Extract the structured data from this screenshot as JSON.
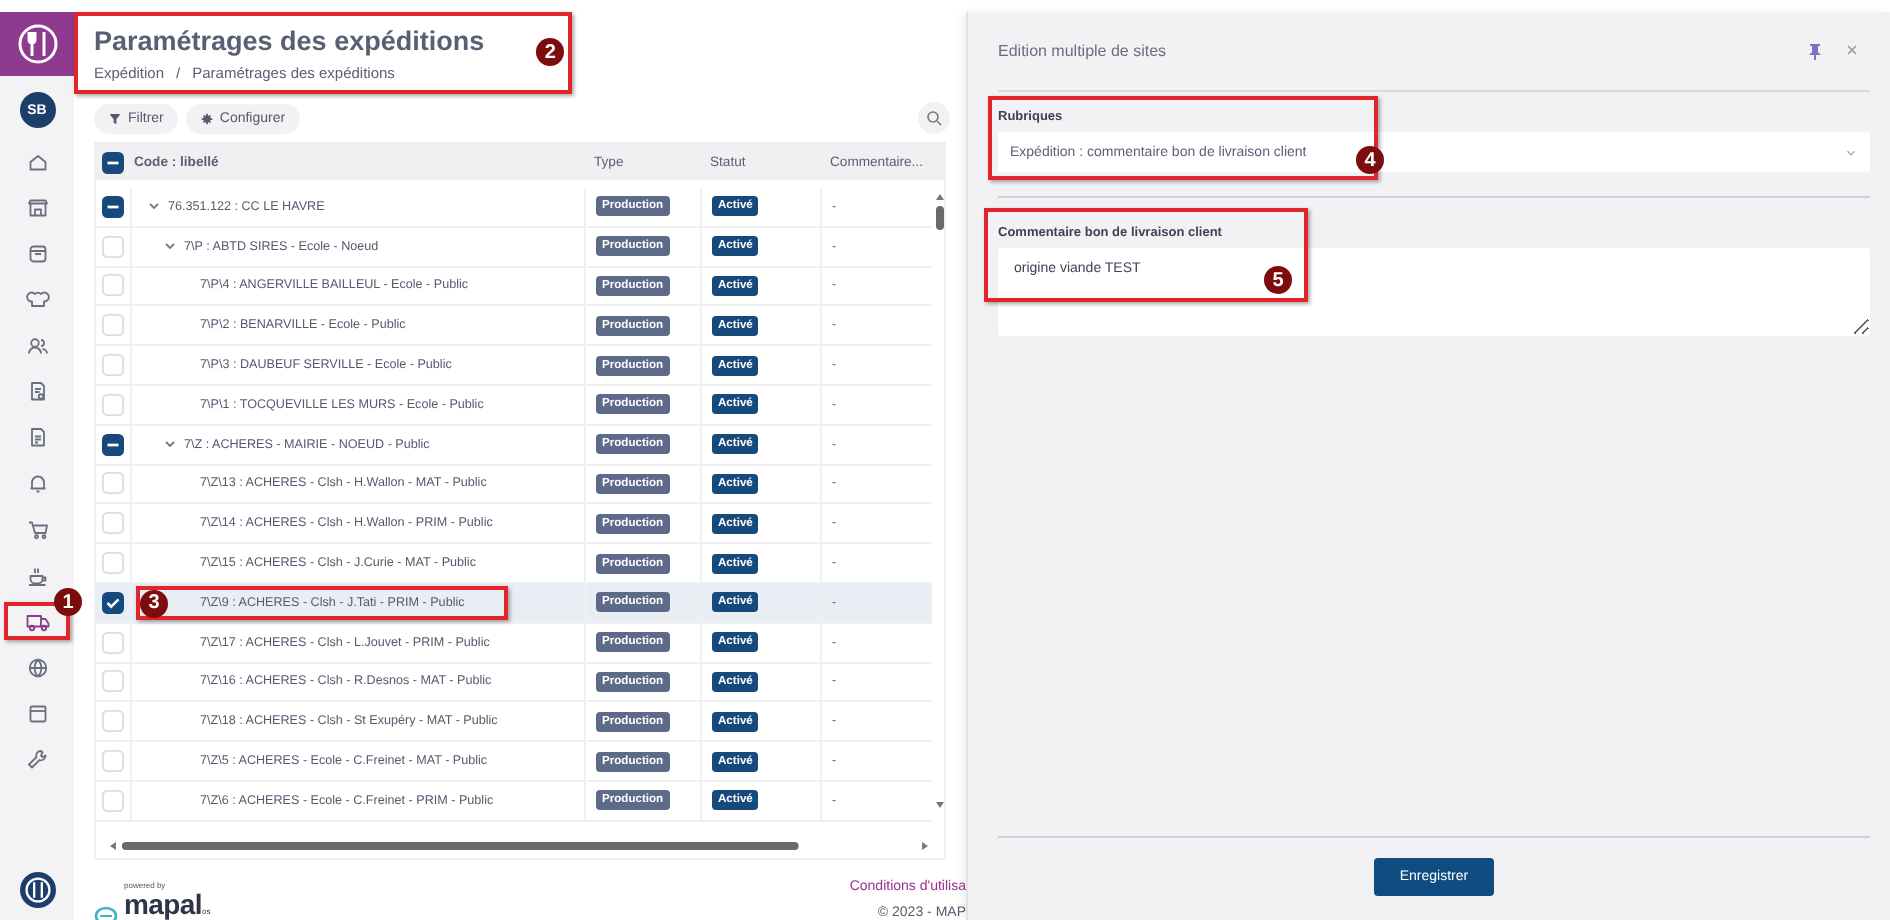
{
  "sidebar": {
    "avatar": "SB",
    "items": [
      {
        "kind": "home",
        "selected": false
      },
      {
        "kind": "store",
        "selected": false
      },
      {
        "kind": "box",
        "selected": false
      },
      {
        "kind": "hat",
        "selected": false
      },
      {
        "kind": "users",
        "selected": false
      },
      {
        "kind": "doc",
        "selected": false
      },
      {
        "kind": "sheet",
        "selected": false
      },
      {
        "kind": "bell",
        "selected": false
      },
      {
        "kind": "cart",
        "selected": false
      },
      {
        "kind": "cup",
        "selected": false
      },
      {
        "kind": "truck",
        "selected": true,
        "callout": "1"
      },
      {
        "kind": "globe",
        "selected": false
      },
      {
        "kind": "calendar",
        "selected": false
      },
      {
        "kind": "wrench",
        "selected": false
      }
    ]
  },
  "page": {
    "title": "Paramétrages des expéditions",
    "breadcrumb": {
      "items": [
        "Expédition",
        "Paramétrages des expéditions"
      ],
      "separator": "/"
    },
    "callout": "2"
  },
  "toolbar": {
    "buttons": [
      {
        "kind": "filter",
        "label": "Filtrer"
      },
      {
        "kind": "gear",
        "label": "Configurer"
      }
    ]
  },
  "table": {
    "header_checkbox": {
      "checked": false,
      "partial": true
    },
    "columns": [
      "Code : libellé",
      "Type",
      "Statut",
      "Commentaire..."
    ],
    "rows": [
      {
        "code": "76.351.122 : CC LE HAVRE",
        "type": "Production",
        "status": "Activé",
        "comment": "-",
        "checked": false,
        "partial": true,
        "selected": false,
        "expanded": true,
        "children": [
          {
            "code": "7\\P : ABTD SIRES - Ecole - Noeud",
            "type": "Production",
            "status": "Activé",
            "comment": "-",
            "checked": false,
            "partial": false,
            "selected": false,
            "expanded": true,
            "children": [
              {
                "code": "7\\P\\4 : ANGERVILLE BAILLEUL - Ecole - Public",
                "type": "Production",
                "status": "Activé",
                "comment": "-",
                "checked": false,
                "partial": false,
                "selected": false
              },
              {
                "code": "7\\P\\2 : BENARVILLE - Ecole - Public",
                "type": "Production",
                "status": "Activé",
                "comment": "-",
                "checked": false,
                "partial": false,
                "selected": false
              },
              {
                "code": "7\\P\\3 : DAUBEUF SERVILLE - Ecole - Public",
                "type": "Production",
                "status": "Activé",
                "comment": "-",
                "checked": false,
                "partial": false,
                "selected": false
              },
              {
                "code": "7\\P\\1 : TOCQUEVILLE LES MURS - Ecole - Public",
                "type": "Production",
                "status": "Activé",
                "comment": "-",
                "checked": false,
                "partial": false,
                "selected": false
              }
            ]
          },
          {
            "code": "7\\Z : ACHERES - MAIRIE - NOEUD - Public",
            "type": "Production",
            "status": "Activé",
            "comment": "-",
            "checked": false,
            "partial": true,
            "selected": false,
            "expanded": true,
            "children": [
              {
                "code": "7\\Z\\13 : ACHERES - Clsh - H.Wallon - MAT - Public",
                "type": "Production",
                "status": "Activé",
                "comment": "-",
                "checked": false,
                "partial": false,
                "selected": false
              },
              {
                "code": "7\\Z\\14 : ACHERES - Clsh - H.Wallon - PRIM - Public",
                "type": "Production",
                "status": "Activé",
                "comment": "-",
                "checked": false,
                "partial": false,
                "selected": false
              },
              {
                "code": "7\\Z\\15 : ACHERES - Clsh - J.Curie - MAT - Public",
                "type": "Production",
                "status": "Activé",
                "comment": "-",
                "checked": false,
                "partial": false,
                "selected": false
              },
              {
                "code": "7\\Z\\9 : ACHERES - Clsh - J.Tati - PRIM - Public",
                "type": "Production",
                "status": "Activé",
                "comment": "-",
                "checked": true,
                "partial": false,
                "selected": true,
                "callout": "3"
              },
              {
                "code": "7\\Z\\17 : ACHERES - Clsh - L.Jouvet - PRIM - Public",
                "type": "Production",
                "status": "Activé",
                "comment": "-",
                "checked": false,
                "partial": false,
                "selected": false
              },
              {
                "code": "7\\Z\\16 : ACHERES - Clsh - R.Desnos - MAT - Public",
                "type": "Production",
                "status": "Activé",
                "comment": "-",
                "checked": false,
                "partial": false,
                "selected": false
              },
              {
                "code": "7\\Z\\18 : ACHERES - Clsh - St Exupéry - MAT - Public",
                "type": "Production",
                "status": "Activé",
                "comment": "-",
                "checked": false,
                "partial": false,
                "selected": false
              },
              {
                "code": "7\\Z\\5 : ACHERES - Ecole - C.Freinet - MAT - Public",
                "type": "Production",
                "status": "Activé",
                "comment": "-",
                "checked": false,
                "partial": false,
                "selected": false
              },
              {
                "code": "7\\Z\\6 : ACHERES - Ecole - C.Freinet - PRIM - Public",
                "type": "Production",
                "status": "Activé",
                "comment": "-",
                "checked": false,
                "partial": false,
                "selected": false
              }
            ]
          }
        ]
      }
    ]
  },
  "footer": {
    "powered_by": "powered by",
    "brand": "mapal",
    "brand_suffix": "os",
    "link": "Conditions d'utilisa",
    "copyright": "© 2023 - MAP"
  },
  "panel": {
    "title": "Edition multiple de sites",
    "rubriques": {
      "label": "Rubriques",
      "value": "Expédition : commentaire bon de livraison client",
      "callout": "4"
    },
    "comment": {
      "label": "Commentaire bon de livraison client",
      "value": "origine viande TEST",
      "callout": "5"
    },
    "save_button": "Enregistrer"
  }
}
